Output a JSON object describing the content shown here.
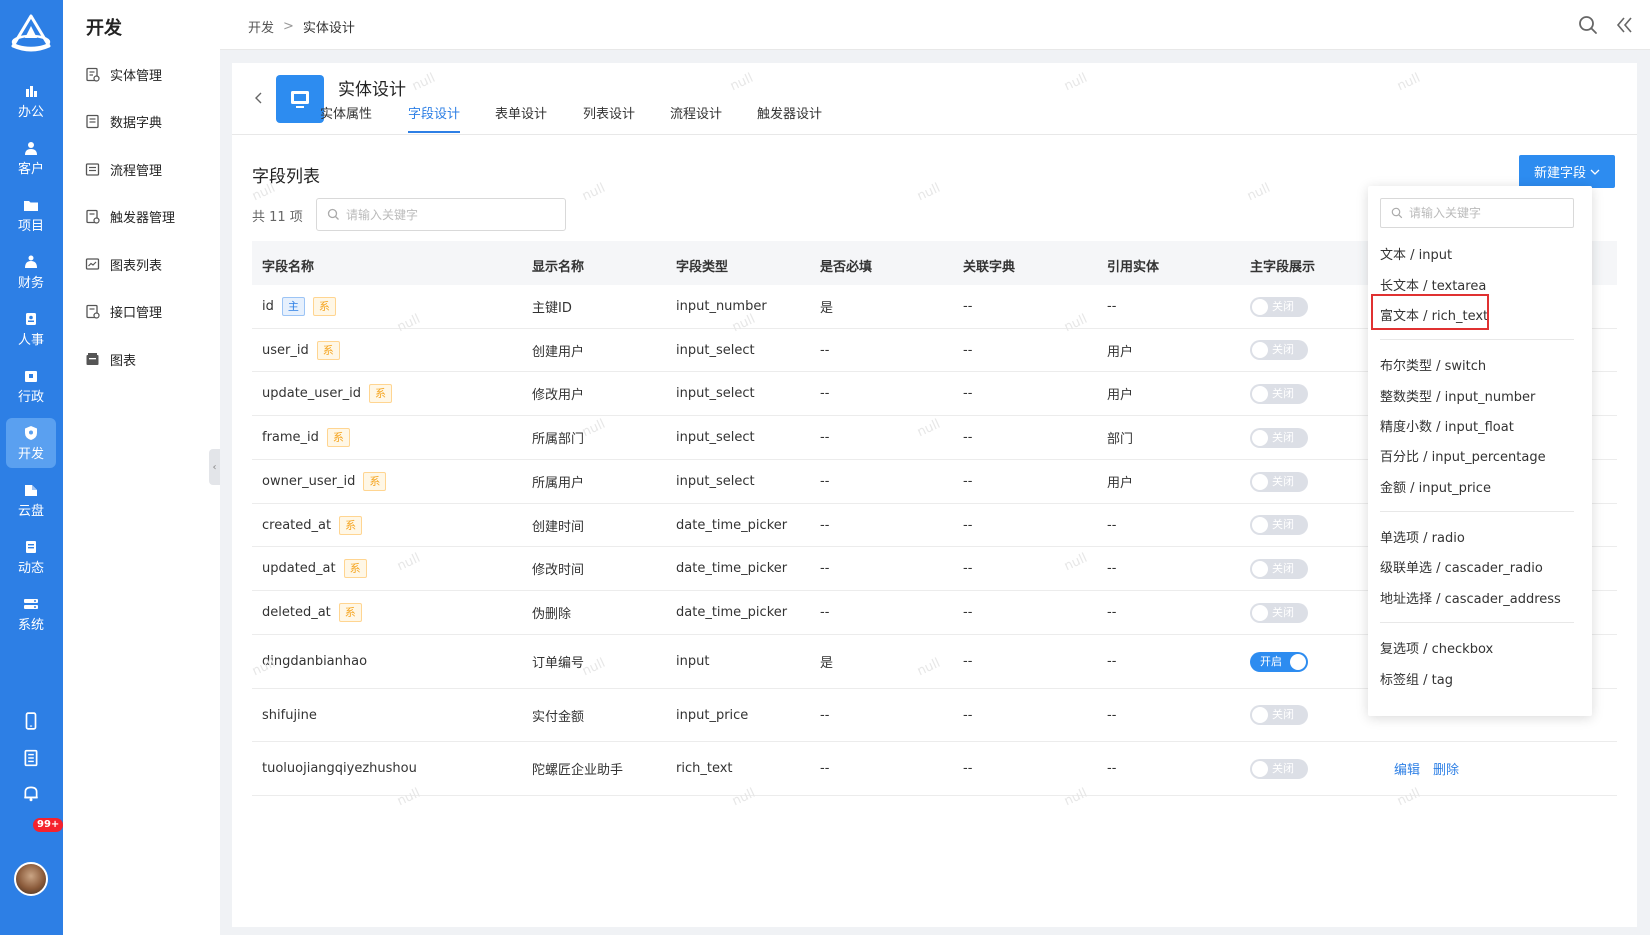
{
  "rail": {
    "items": [
      {
        "label": "办公",
        "icon": "office-icon"
      },
      {
        "label": "客户",
        "icon": "customer-icon"
      },
      {
        "label": "项目",
        "icon": "project-icon"
      },
      {
        "label": "财务",
        "icon": "finance-icon"
      },
      {
        "label": "人事",
        "icon": "hr-icon"
      },
      {
        "label": "行政",
        "icon": "admin-icon"
      },
      {
        "label": "开发",
        "icon": "dev-icon",
        "active": true
      },
      {
        "label": "云盘",
        "icon": "cloud-icon"
      },
      {
        "label": "动态",
        "icon": "feed-icon"
      },
      {
        "label": "系统",
        "icon": "system-icon"
      }
    ],
    "notification_badge": "99+"
  },
  "sidebar": {
    "title": "开发",
    "items": [
      {
        "label": "实体管理"
      },
      {
        "label": "数据字典"
      },
      {
        "label": "流程管理"
      },
      {
        "label": "触发器管理"
      },
      {
        "label": "图表列表"
      },
      {
        "label": "接口管理"
      },
      {
        "label": "图表"
      }
    ]
  },
  "breadcrumb": [
    "开发",
    "实体设计"
  ],
  "entity": {
    "title": "实体设计",
    "tabs": [
      {
        "label": "实体属性"
      },
      {
        "label": "字段设计",
        "active": true
      },
      {
        "label": "表单设计"
      },
      {
        "label": "列表设计"
      },
      {
        "label": "流程设计"
      },
      {
        "label": "触发器设计"
      }
    ]
  },
  "field_list": {
    "title": "字段列表",
    "count": "共 11 项",
    "search_placeholder": "请输入关键字",
    "new_button": "新建字段",
    "columns": [
      "字段名称",
      "显示名称",
      "字段类型",
      "是否必填",
      "关联字典",
      "引用实体",
      "主字段展示"
    ],
    "tag_pk": "主",
    "tag_sys": "系",
    "toggle_off": "关闭",
    "toggle_on": "开启",
    "rows": [
      {
        "name": "id",
        "display": "主键ID",
        "type": "input_number",
        "required": "是",
        "dict": "--",
        "ref": "--",
        "pk": true,
        "sys": true,
        "main": false
      },
      {
        "name": "user_id",
        "display": "创建用户",
        "type": "input_select",
        "required": "--",
        "dict": "--",
        "ref": "用户",
        "sys": true,
        "main": false
      },
      {
        "name": "update_user_id",
        "display": "修改用户",
        "type": "input_select",
        "required": "--",
        "dict": "--",
        "ref": "用户",
        "sys": true,
        "main": false
      },
      {
        "name": "frame_id",
        "display": "所属部门",
        "type": "input_select",
        "required": "--",
        "dict": "--",
        "ref": "部门",
        "sys": true,
        "main": false
      },
      {
        "name": "owner_user_id",
        "display": "所属用户",
        "type": "input_select",
        "required": "--",
        "dict": "--",
        "ref": "用户",
        "sys": true,
        "main": false
      },
      {
        "name": "created_at",
        "display": "创建时间",
        "type": "date_time_picker",
        "required": "--",
        "dict": "--",
        "ref": "--",
        "sys": true,
        "main": false
      },
      {
        "name": "updated_at",
        "display": "修改时间",
        "type": "date_time_picker",
        "required": "--",
        "dict": "--",
        "ref": "--",
        "sys": true,
        "main": false
      },
      {
        "name": "deleted_at",
        "display": "伪删除",
        "type": "date_time_picker",
        "required": "--",
        "dict": "--",
        "ref": "--",
        "sys": true,
        "main": false
      },
      {
        "name": "dingdanbianhao",
        "display": "订单编号",
        "type": "input",
        "required": "是",
        "dict": "--",
        "ref": "--",
        "main": true
      },
      {
        "name": "shifujine",
        "display": "实付金额",
        "type": "input_price",
        "required": "--",
        "dict": "--",
        "ref": "--",
        "main": false
      },
      {
        "name": "tuoluojiangqiyezhushou",
        "display": "陀螺匠企业助手",
        "type": "rich_text",
        "required": "--",
        "dict": "--",
        "ref": "--",
        "main": false,
        "ops": [
          "编辑",
          "删除"
        ]
      }
    ]
  },
  "watermark": "null",
  "dropdown": {
    "search_placeholder": "请输入关键字",
    "groups": [
      [
        "文本 / input",
        "长文本 / textarea",
        "富文本 / rich_text"
      ],
      [
        "布尔类型 / switch",
        "整数类型 / input_number",
        "精度小数 / input_float",
        "百分比 / input_percentage",
        "金额 / input_price"
      ],
      [
        "单选项 / radio",
        "级联单选 / cascader_radio",
        "地址选择 / cascader_address"
      ],
      [
        "复选项 / checkbox",
        "标签组 / tag"
      ]
    ],
    "highlighted": "富文本 / rich_text"
  },
  "colors": {
    "primary": "#2d7fe5",
    "button": "#2d8cf0",
    "rail": "#2d7fe5",
    "highlight_border": "#e03131"
  }
}
